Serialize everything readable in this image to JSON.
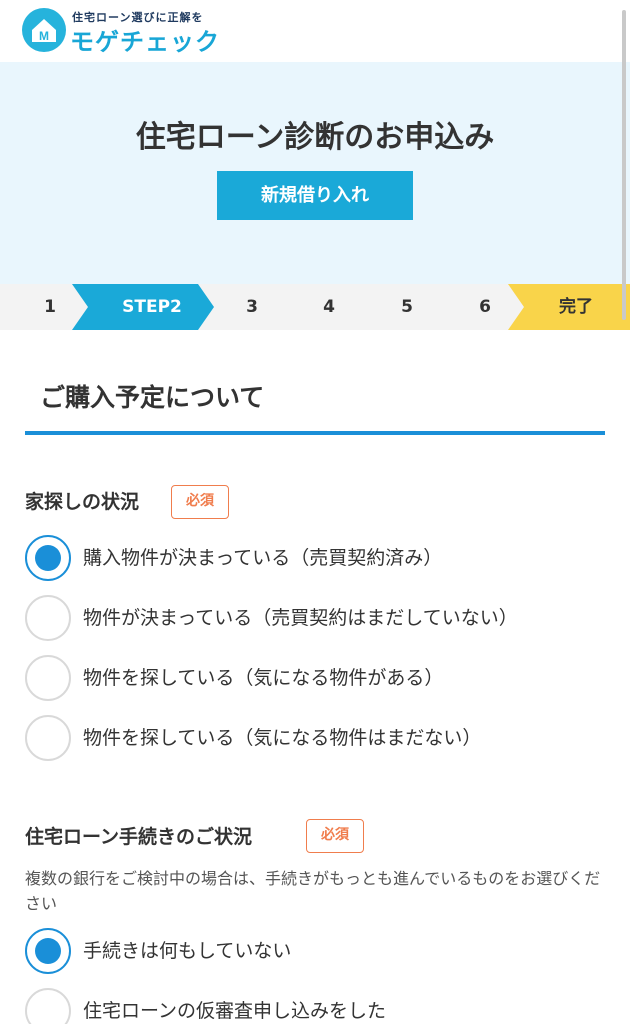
{
  "header": {
    "tagline": "住宅ローン選びに正解を",
    "brand_name": "モゲチェック",
    "logo_letter": "M"
  },
  "hero": {
    "title": "住宅ローン診断のお申込み",
    "button_label": "新規借り入れ"
  },
  "steps": {
    "items": [
      {
        "label": "1",
        "state": "done"
      },
      {
        "label": "STEP2",
        "state": "active"
      },
      {
        "label": "3",
        "state": "todo"
      },
      {
        "label": "4",
        "state": "todo"
      },
      {
        "label": "5",
        "state": "todo"
      },
      {
        "label": "6",
        "state": "todo"
      },
      {
        "label": "完了",
        "state": "final"
      }
    ]
  },
  "section": {
    "title": "ご購入予定について"
  },
  "questions": [
    {
      "label": "家探しの状況",
      "required_badge": "必須",
      "options": [
        {
          "label": "購入物件が決まっている（売買契約済み）",
          "checked": true
        },
        {
          "label": "物件が決まっている（売買契約はまだしていない）",
          "checked": false
        },
        {
          "label": "物件を探している（気になる物件がある）",
          "checked": false
        },
        {
          "label": "物件を探している（気になる物件はまだない）",
          "checked": false
        }
      ]
    },
    {
      "label": "住宅ローン手続きのご状況",
      "required_badge": "必須",
      "description": "複数の銀行をご検討中の場合は、手続きがもっとも進んでいるものをお選びください",
      "options": [
        {
          "label": "手続きは何もしていない",
          "checked": true
        },
        {
          "label": "住宅ローンの仮審査申し込みをした",
          "checked": false
        }
      ]
    }
  ],
  "colors": {
    "brand": "#18a6d6",
    "hero_bg": "#e9f6fd",
    "active_step": "#1aa9d8",
    "final_step": "#f9d44a",
    "radio_checked": "#1a8fd8",
    "required_badge": "#f07d4d"
  }
}
